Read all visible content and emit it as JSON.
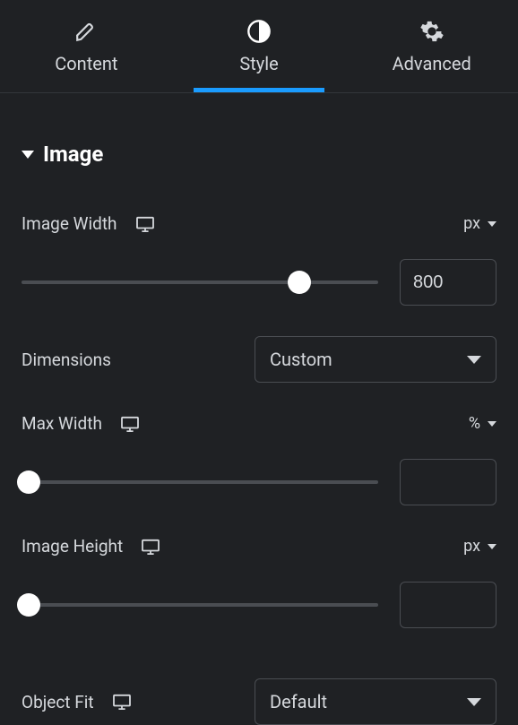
{
  "tabs": {
    "content": {
      "label": "Content"
    },
    "style": {
      "label": "Style"
    },
    "advanced": {
      "label": "Advanced"
    }
  },
  "section": {
    "title": "Image"
  },
  "controls": {
    "image_width": {
      "label": "Image Width",
      "unit": "px",
      "value": "800",
      "slider_pct": 78
    },
    "dimensions": {
      "label": "Dimensions",
      "value": "Custom"
    },
    "max_width": {
      "label": "Max Width",
      "unit": "%",
      "value": "",
      "slider_pct": 0
    },
    "image_height": {
      "label": "Image Height",
      "unit": "px",
      "value": "",
      "slider_pct": 0
    },
    "object_fit": {
      "label": "Object Fit",
      "value": "Default"
    }
  }
}
